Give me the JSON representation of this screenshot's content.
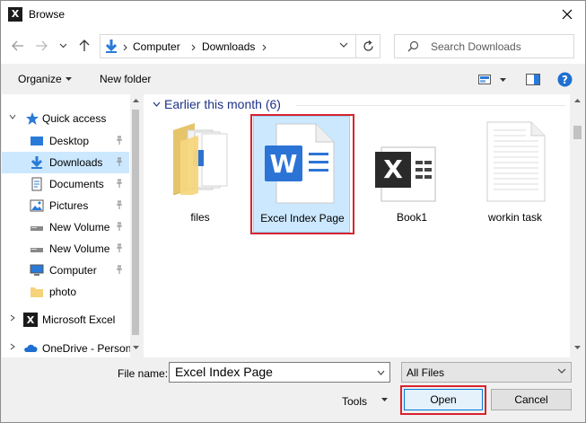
{
  "window": {
    "title": "Browse",
    "app_icon": "excel-x-icon"
  },
  "nav": {
    "address_segments": [
      "Computer",
      "Downloads"
    ],
    "search_placeholder": "Search Downloads"
  },
  "toolbar": {
    "organize_label": "Organize",
    "new_folder_label": "New folder"
  },
  "sidebar": {
    "quick_access": "Quick access",
    "items": [
      {
        "label": "Desktop",
        "icon": "desktop-icon",
        "pinned": true
      },
      {
        "label": "Downloads",
        "icon": "download-icon",
        "pinned": true,
        "selected": true
      },
      {
        "label": "Documents",
        "icon": "documents-icon",
        "pinned": true
      },
      {
        "label": "Pictures",
        "icon": "pictures-icon",
        "pinned": true
      },
      {
        "label": "New Volume",
        "icon": "drive-icon",
        "pinned": true
      },
      {
        "label": "New Volume",
        "icon": "drive-icon",
        "pinned": true
      },
      {
        "label": "Computer",
        "icon": "computer-icon",
        "pinned": true
      },
      {
        "label": "photo",
        "icon": "folder-icon",
        "pinned": false
      }
    ],
    "microsoft_excel": "Microsoft Excel",
    "onedrive": "OneDrive - Person"
  },
  "content": {
    "group_header": "Earlier this month (6)",
    "files": [
      {
        "name": "files",
        "icon": "folder-icon"
      },
      {
        "name": "Excel Index Page",
        "icon": "word-doc-icon",
        "selected": true
      },
      {
        "name": "Book1",
        "icon": "excel-doc-icon"
      },
      {
        "name": "workin task",
        "icon": "text-doc-icon"
      }
    ]
  },
  "bottom": {
    "file_name_label": "File name:",
    "file_name_value": "Excel Index Page",
    "file_type_value": "All Files",
    "tools_label": "Tools",
    "open_label": "Open",
    "cancel_label": "Cancel"
  },
  "colors": {
    "accent": "#0078d7",
    "highlight_red": "#d9232d",
    "selection": "#cce8ff"
  }
}
